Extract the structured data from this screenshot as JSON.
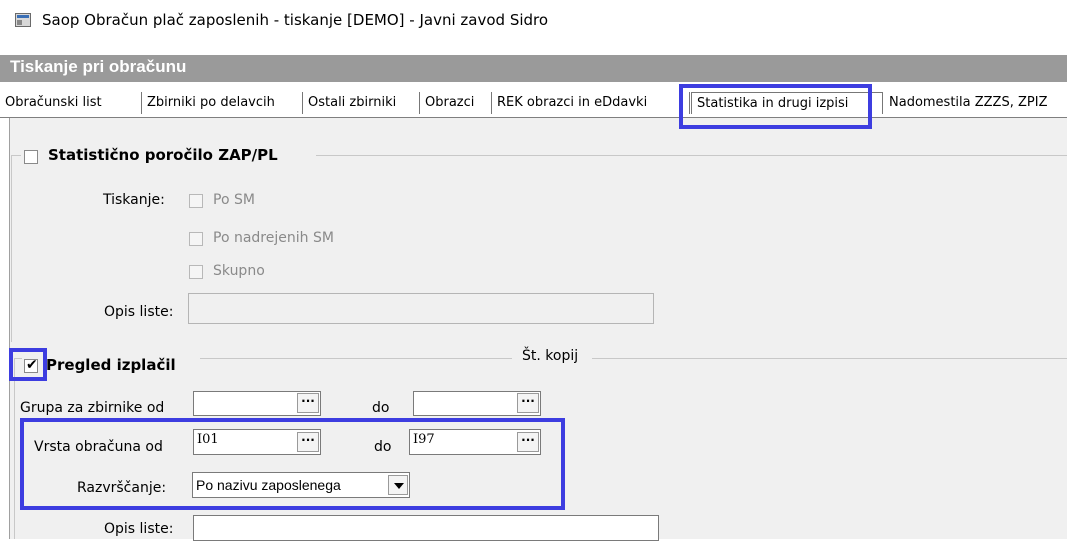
{
  "window": {
    "title": "Saop Obračun plač zaposlenih - tiskanje [DEMO] - Javni zavod Sidro",
    "icon": "app-window-icon"
  },
  "header": {
    "title": "Tiskanje pri obračunu"
  },
  "tabs": [
    {
      "label": "Obračunski list"
    },
    {
      "label": "Zbirniki po delavcih"
    },
    {
      "label": "Ostali zbirniki"
    },
    {
      "label": "Obrazci"
    },
    {
      "label": "REK obrazci  in eDdavki"
    },
    {
      "label": "Statistika in drugi izpisi",
      "active": true
    },
    {
      "label": "Nadomestila ZZZS, ZPIZ"
    }
  ],
  "stat_group": {
    "title": "Statistično poročilo ZAP/PL",
    "checked": false,
    "tiskanje_label": "Tiskanje:",
    "options": [
      {
        "label": "Po SM",
        "checked": false
      },
      {
        "label": "Po nadrejenih SM",
        "checked": false
      },
      {
        "label": "Skupno",
        "checked": false
      }
    ],
    "opis_label": "Opis liste:",
    "opis_value": ""
  },
  "pregled_group": {
    "title": "Pregled izplačil",
    "checked": true,
    "kopij_label": "Št. kopij",
    "grupa_label": "Grupa za zbirnike od",
    "grupa_od": "",
    "grupa_do": "",
    "do_label": "do",
    "vrsta_label": "Vrsta obračuna od",
    "vrsta_od": "I01",
    "vrsta_do": "I97",
    "razvrscanje_label": "Razvrščanje:",
    "razvrscanje_value": "Po nazivu zaposlenega",
    "opis_label": "Opis liste:",
    "opis_value": "",
    "ellipsis": "···"
  },
  "colors": {
    "highlight": "#3d3de0",
    "header_band": "#9a9a9a",
    "panel": "#f0f0f0"
  }
}
